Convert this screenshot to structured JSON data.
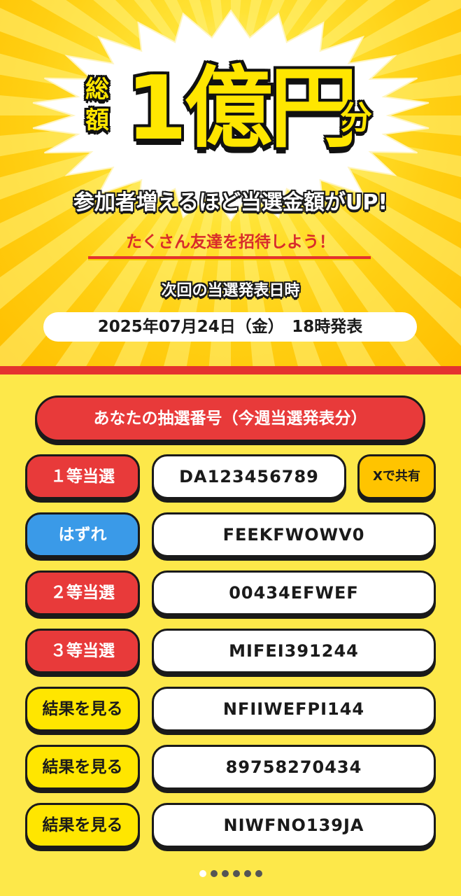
{
  "hero": {
    "total_label": "総額",
    "amount": "1億円",
    "suffix": "分",
    "tagline": "参加者増えるほど当選金額がUP!",
    "invite": "たくさん友達を招待しよう！",
    "next_draw_label": "次回の当選発表日時",
    "next_draw_date": "2025年07月24日（金）　18時発表"
  },
  "list": {
    "header": "あなたの抽選番号（今週当選発表分）",
    "share_label": "Xで共有",
    "rows": [
      {
        "status": "１等当選",
        "status_type": "win",
        "number": "DA123456789"
      },
      {
        "status": "はずれ",
        "status_type": "lose",
        "number": "FEEKFWOWV0"
      },
      {
        "status": "２等当選",
        "status_type": "win",
        "number": "00434EFWEF"
      },
      {
        "status": "３等当選",
        "status_type": "win",
        "number": "MIFEI391244"
      },
      {
        "status": "結果を見る",
        "status_type": "view",
        "number": "NFIIWEFPI144"
      },
      {
        "status": "結果を見る",
        "status_type": "view",
        "number": "89758270434"
      },
      {
        "status": "結果を見る",
        "status_type": "view",
        "number": "NIWFNO139JA"
      }
    ]
  },
  "pager": {
    "count": 6,
    "active": 0
  },
  "colors": {
    "accent_red": "#e83a3a",
    "accent_blue": "#3a9ae8",
    "accent_yellow": "#ffe600",
    "background": "#fde84a"
  }
}
